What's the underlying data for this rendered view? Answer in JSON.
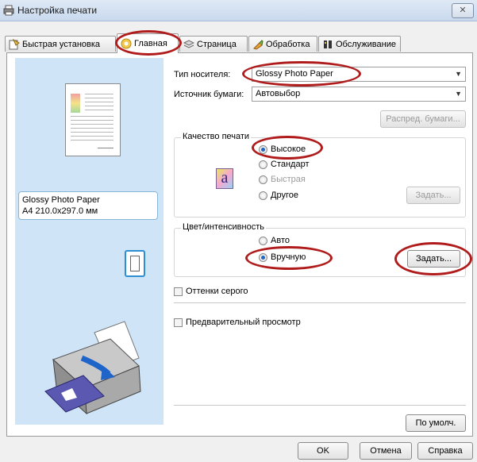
{
  "window": {
    "title": "Настройка печати",
    "close_label": "✕"
  },
  "tabs": [
    {
      "label": "Быстрая установка"
    },
    {
      "label": "Главная"
    },
    {
      "label": "Страница"
    },
    {
      "label": "Обработка"
    },
    {
      "label": "Обслуживание"
    }
  ],
  "preview": {
    "paper_name": "Glossy Photo Paper",
    "paper_size": "A4 210.0x297.0 мм"
  },
  "media": {
    "type_label": "Тип носителя:",
    "type_value": "Glossy Photo Paper",
    "source_label": "Источник бумаги:",
    "source_value": "Автовыбор",
    "distribute_button": "Распред. бумаги..."
  },
  "quality": {
    "title": "Качество печати",
    "icon_glyph": "a",
    "options": [
      {
        "label": "Высокое",
        "selected": true,
        "enabled": true
      },
      {
        "label": "Стандарт",
        "selected": false,
        "enabled": true
      },
      {
        "label": "Быстрая",
        "selected": false,
        "enabled": false
      },
      {
        "label": "Другое",
        "selected": false,
        "enabled": true
      }
    ],
    "set_button": "Задать..."
  },
  "color": {
    "title": "Цвет/интенсивность",
    "options": [
      {
        "label": "Авто",
        "selected": false
      },
      {
        "label": "Вручную",
        "selected": true
      }
    ],
    "set_button": "Задать..."
  },
  "grayscale_label": "Оттенки серого",
  "preview_checkbox_label": "Предварительный просмотр",
  "defaults_button": "По умолч.",
  "footer": {
    "ok": "OK",
    "cancel": "Отмена",
    "help": "Справка"
  },
  "colors": {
    "annotation": "#b01c1c",
    "preview_bg": "#cfe4f6",
    "accent_blue": "#2e8fd0"
  }
}
